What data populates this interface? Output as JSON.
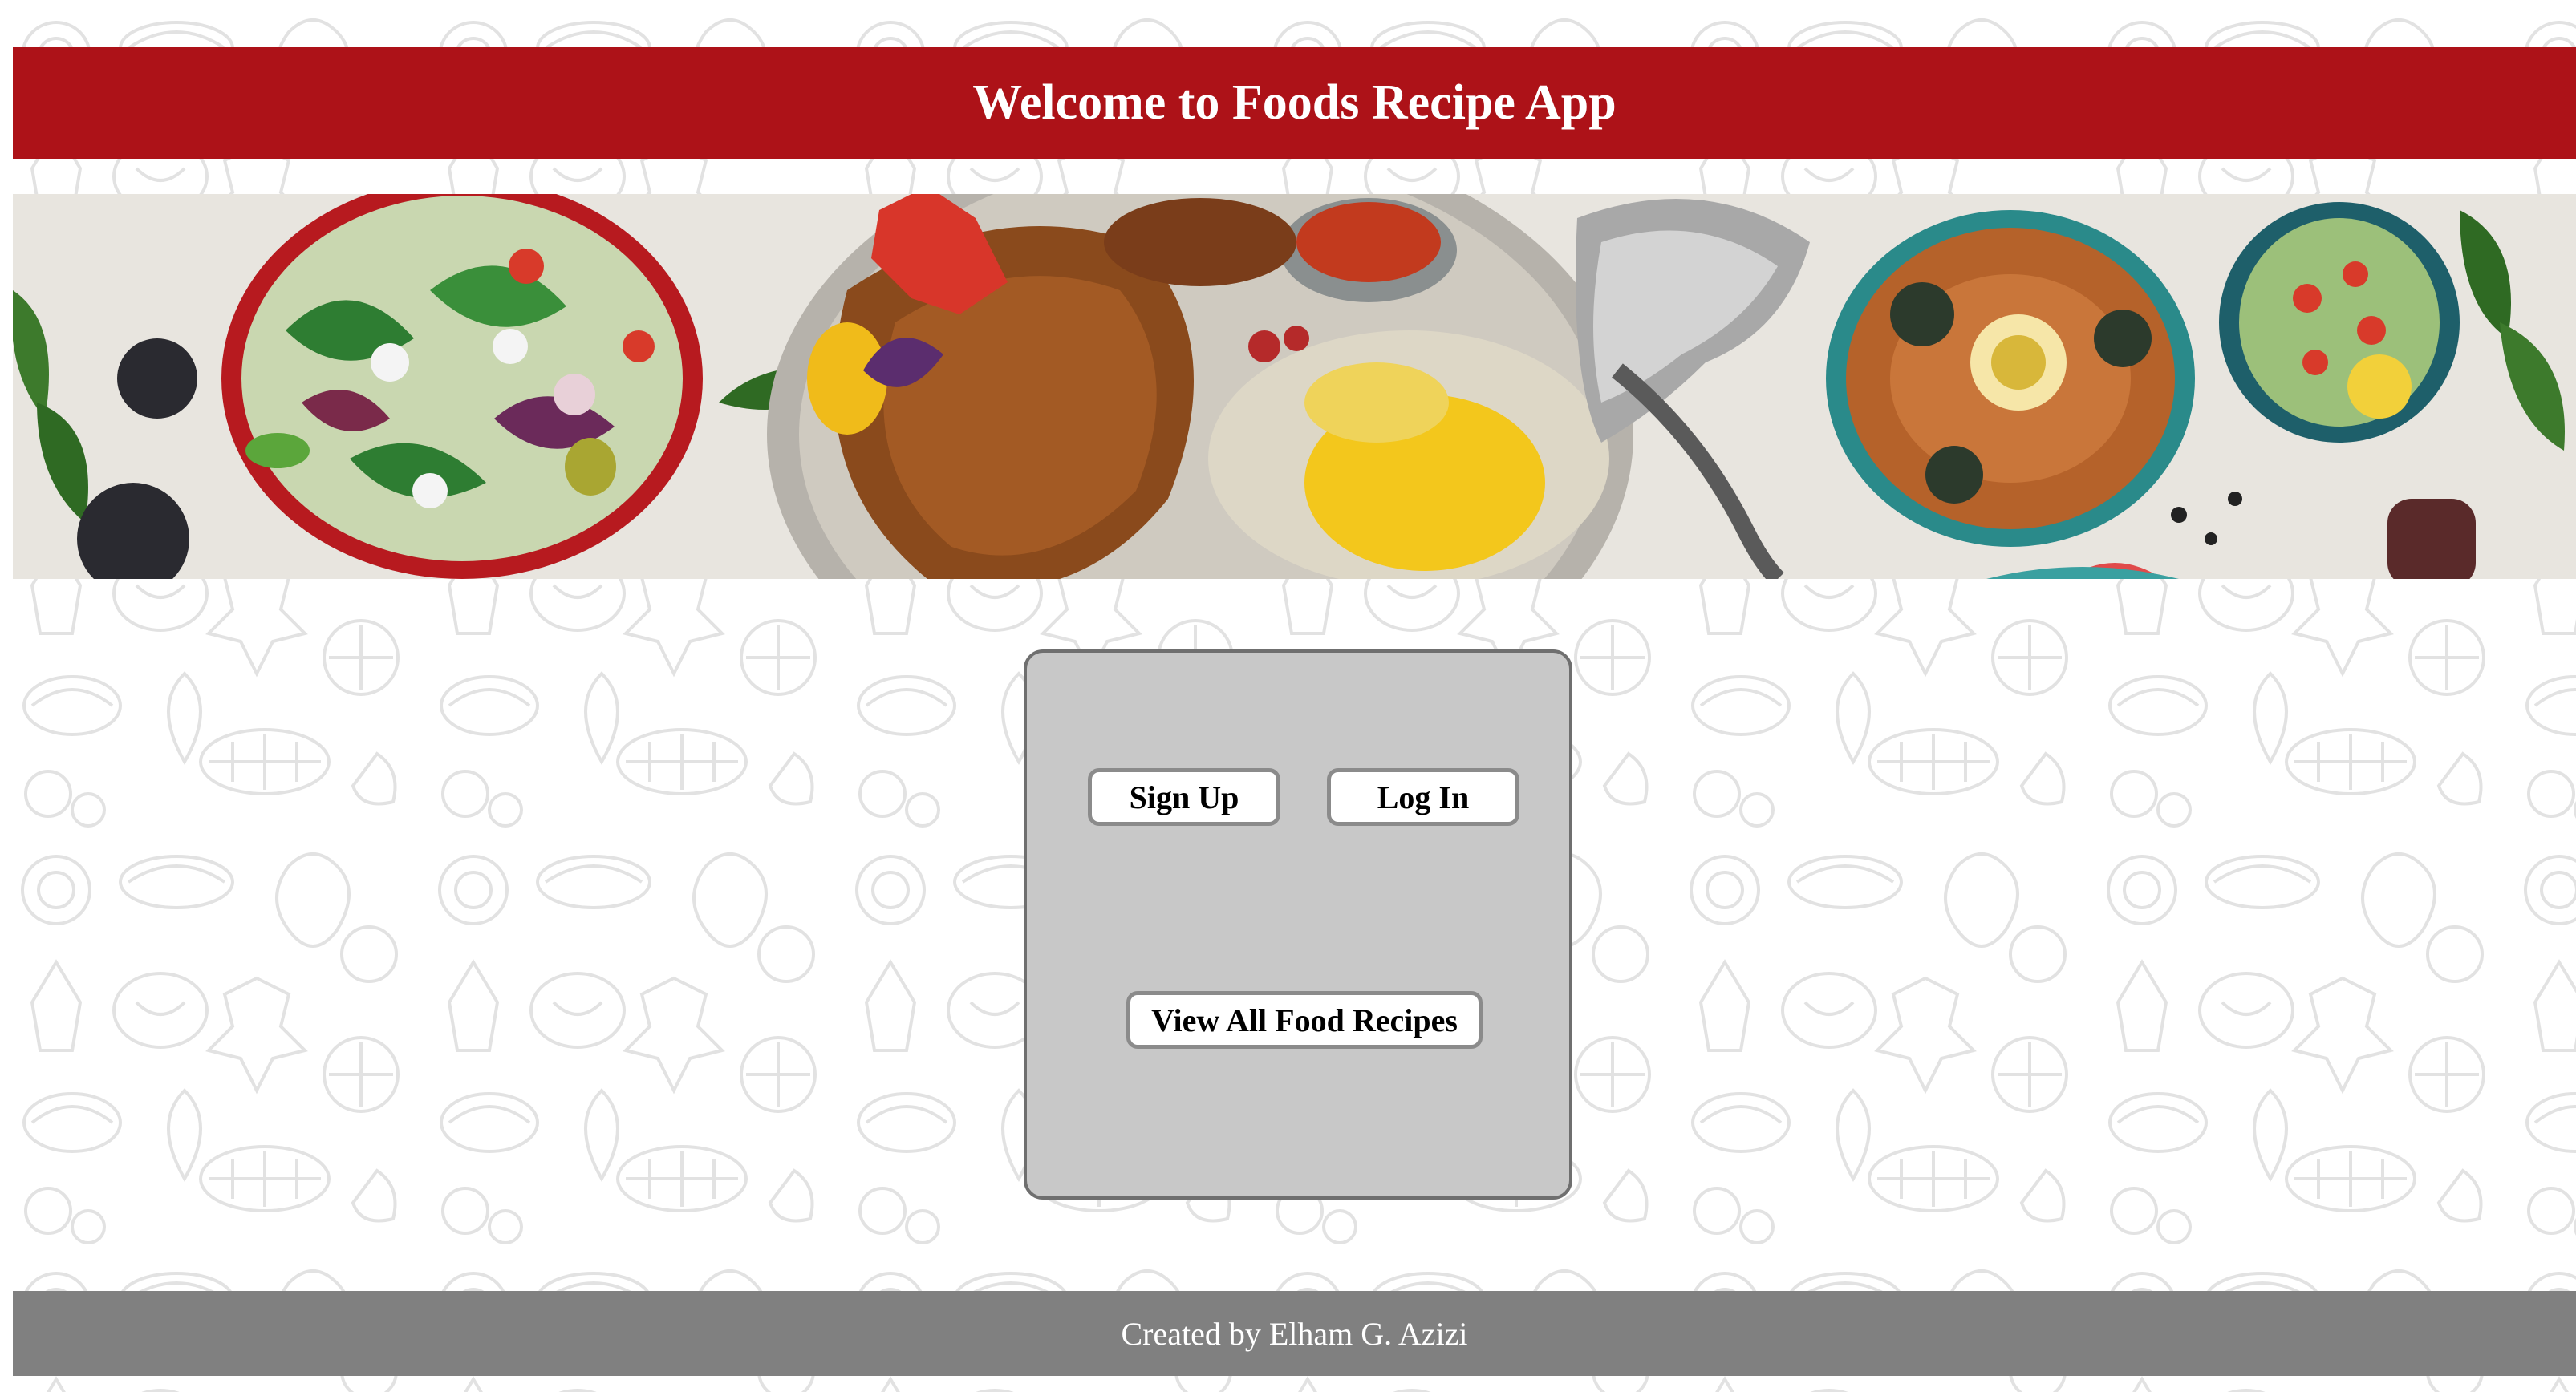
{
  "header": {
    "title": "Welcome to Foods Recipe App"
  },
  "banner": {
    "image_description_icon": "food-spread-banner"
  },
  "panel": {
    "signup_label": "Sign Up",
    "login_label": "Log In",
    "view_all_label": "View All Food Recipes"
  },
  "footer": {
    "credit": "Created by Elham G. Azizi"
  },
  "colors": {
    "header_bg": "#ad1218",
    "panel_bg": "#c8c8c8",
    "footer_bg": "#808080",
    "pattern_stroke": "#e2e2e2"
  }
}
